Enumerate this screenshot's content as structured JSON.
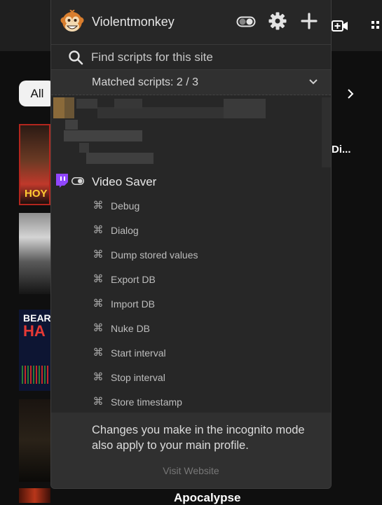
{
  "background": {
    "chip_all": "All",
    "video_title_right": "Di...",
    "video_title_bottom": "Apocalypse",
    "thumb1_text": "HOY",
    "thumb3_text_top": "BEAR",
    "thumb3_text_main": "HA"
  },
  "popup": {
    "title": "Violentmonkey",
    "search": {
      "placeholder": "Find scripts for this site"
    },
    "matched_label": "Matched scripts: 2 / 3",
    "script": {
      "name": "Video Saver",
      "enabled": true
    },
    "commands": [
      {
        "label": "Debug"
      },
      {
        "label": "Dialog"
      },
      {
        "label": "Dump stored values"
      },
      {
        "label": "Export DB"
      },
      {
        "label": "Import DB"
      },
      {
        "label": "Nuke DB"
      },
      {
        "label": "Start interval"
      },
      {
        "label": "Stop interval"
      },
      {
        "label": "Store timestamp"
      }
    ],
    "command_icon_glyph": "⌘",
    "notice": "Changes you make in the incognito mode also apply to your main profile.",
    "visit_website": "Visit Website"
  },
  "icons": [
    "violentmonkey-logo-icon",
    "toggle-icon",
    "gear-icon",
    "plus-icon",
    "search-icon",
    "chevron-down-icon",
    "twitch-icon",
    "command-icon",
    "create-video-icon",
    "apps-grid-icon",
    "chevron-right-icon"
  ],
  "colors": {
    "popup_bg": "#272727",
    "page_bg": "#0f0f0f",
    "twitch": "#9146ff",
    "accent_text": "#e3e3e3"
  }
}
